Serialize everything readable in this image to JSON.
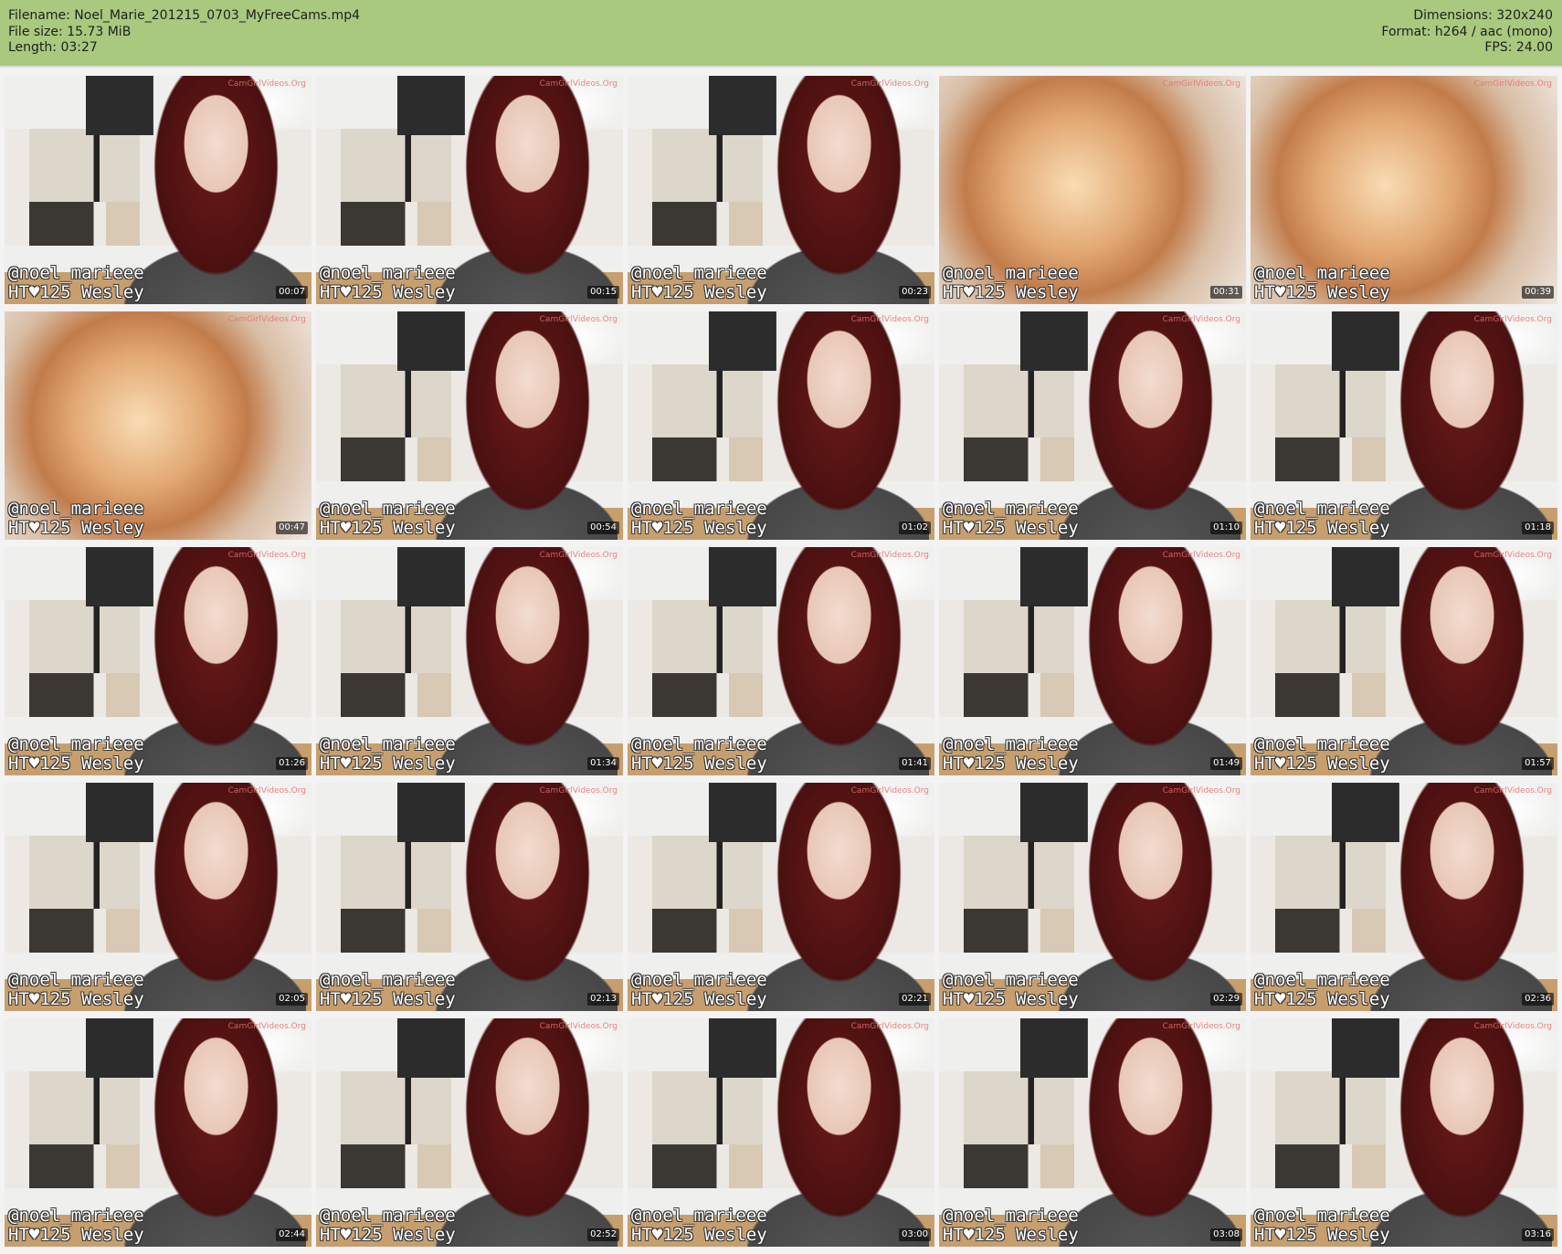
{
  "header": {
    "filename_line": "Filename: Noel_Marie_201215_0703_MyFreeCams.mp4",
    "filesize_line": "File size: 15.73 MiB",
    "length_line": "Length: 03:27",
    "dimensions_line": "Dimensions: 320x240",
    "format_line": "Format: h264 / aac (mono)",
    "fps_line": "FPS: 24.00"
  },
  "caption": {
    "handle": "@noel_marieee",
    "tip_line": "HT♥125 Wesley",
    "watermark": "CamGirlVideos.Org"
  },
  "thumbnails": [
    {
      "time": "00:07",
      "kind": "room",
      "show_handle": true,
      "show_tip": true
    },
    {
      "time": "00:15",
      "kind": "room",
      "show_handle": true,
      "show_tip": true
    },
    {
      "time": "00:23",
      "kind": "room",
      "show_handle": true,
      "show_tip": true
    },
    {
      "time": "00:31",
      "kind": "closeup",
      "show_handle": true,
      "show_tip": true
    },
    {
      "time": "00:39",
      "kind": "closeup",
      "show_handle": true,
      "show_tip": true
    },
    {
      "time": "00:47",
      "kind": "closeup",
      "show_handle": true,
      "show_tip": true
    },
    {
      "time": "00:54",
      "kind": "room",
      "show_handle": true,
      "show_tip": true
    },
    {
      "time": "01:02",
      "kind": "room",
      "show_handle": true,
      "show_tip": true
    },
    {
      "time": "01:10",
      "kind": "room",
      "show_handle": true,
      "show_tip": true
    },
    {
      "time": "01:18",
      "kind": "room",
      "show_handle": true,
      "show_tip": true
    },
    {
      "time": "01:26",
      "kind": "room",
      "show_handle": true,
      "show_tip": true
    },
    {
      "time": "01:34",
      "kind": "room",
      "show_handle": true,
      "show_tip": true
    },
    {
      "time": "01:41",
      "kind": "room",
      "show_handle": true,
      "show_tip": true
    },
    {
      "time": "01:49",
      "kind": "room",
      "show_handle": true,
      "show_tip": true
    },
    {
      "time": "01:57",
      "kind": "room",
      "show_handle": true,
      "show_tip": true
    },
    {
      "time": "02:05",
      "kind": "room",
      "show_handle": true,
      "show_tip": true
    },
    {
      "time": "02:13",
      "kind": "room",
      "show_handle": true,
      "show_tip": true
    },
    {
      "time": "02:21",
      "kind": "room",
      "show_handle": true,
      "show_tip": true
    },
    {
      "time": "02:29",
      "kind": "room",
      "show_handle": true,
      "show_tip": true
    },
    {
      "time": "02:36",
      "kind": "room",
      "show_handle": true,
      "show_tip": true
    },
    {
      "time": "02:44",
      "kind": "room",
      "show_handle": true,
      "show_tip": true
    },
    {
      "time": "02:52",
      "kind": "room",
      "show_handle": true,
      "show_tip": true
    },
    {
      "time": "03:00",
      "kind": "room",
      "show_handle": true,
      "show_tip": true
    },
    {
      "time": "03:08",
      "kind": "room",
      "show_handle": true,
      "show_tip": true
    },
    {
      "time": "03:16",
      "kind": "room",
      "show_handle": true,
      "show_tip": true
    }
  ]
}
